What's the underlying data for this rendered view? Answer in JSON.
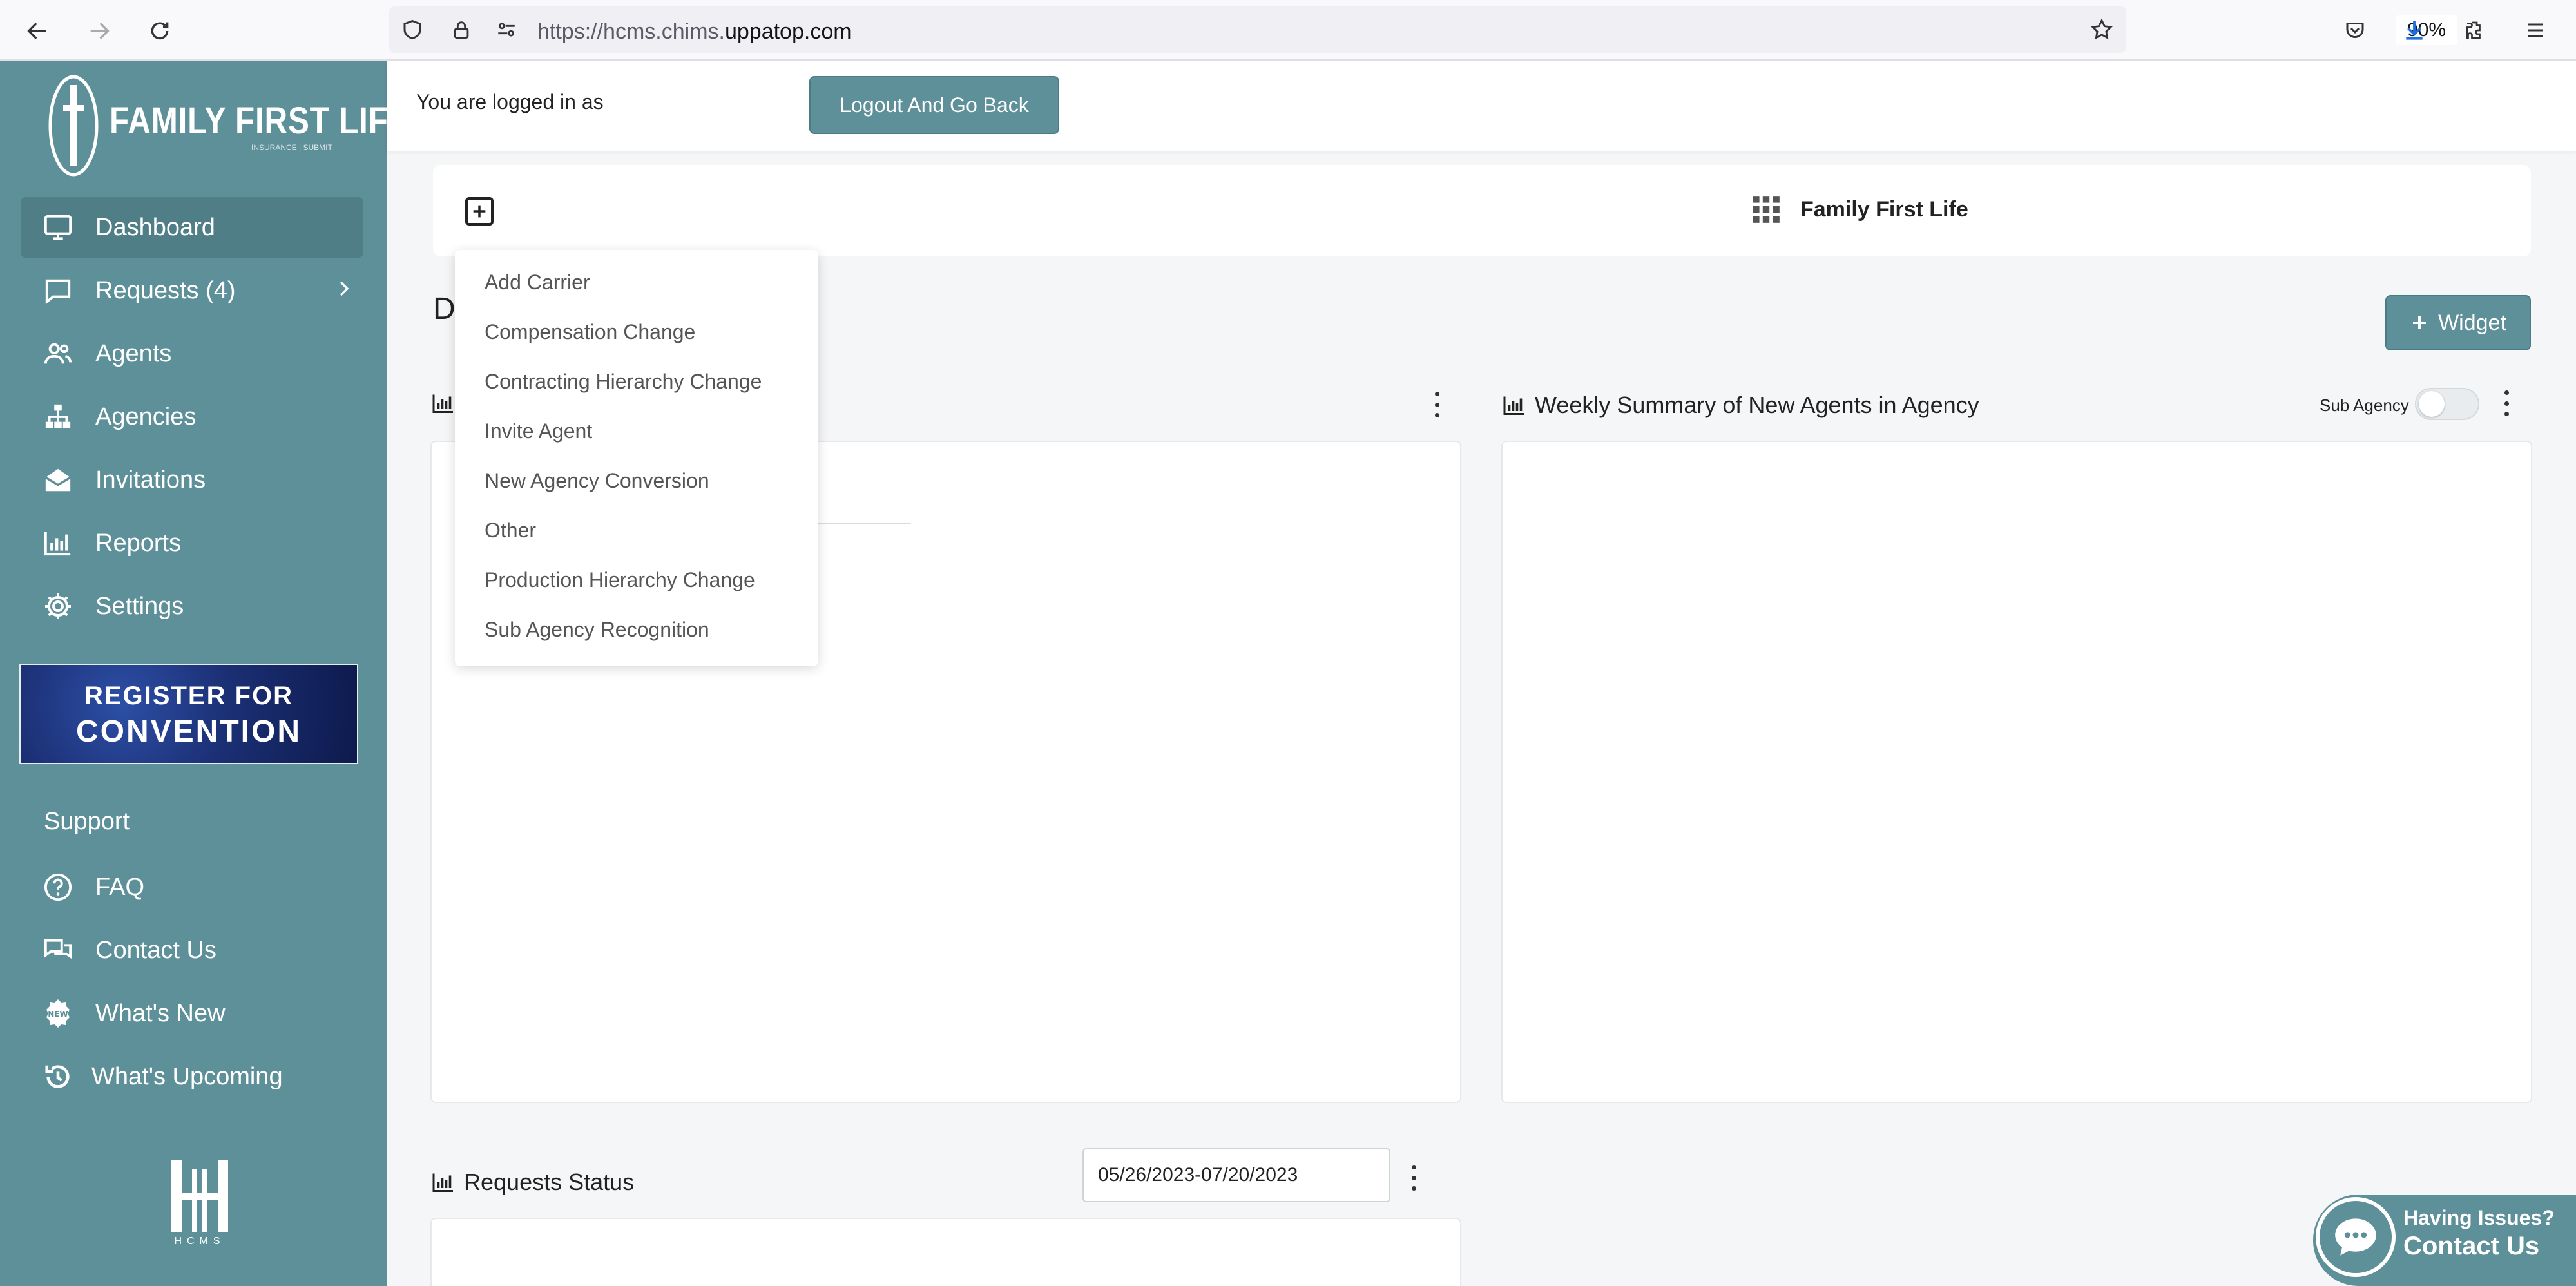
{
  "browser": {
    "url_prefix": "https://hcms.chims.",
    "url_host": "uppatop.com",
    "zoom": "90%"
  },
  "sidebar": {
    "logo_text": "FAMILY FIRST LIFE",
    "logo_sub": "INSURANCE | SUBMIT",
    "items": [
      {
        "label": "Dashboard",
        "icon": "monitor-icon"
      },
      {
        "label": "Requests (4)",
        "icon": "chat-icon"
      },
      {
        "label": "Agents",
        "icon": "users-icon"
      },
      {
        "label": "Agencies",
        "icon": "hierarchy-icon"
      },
      {
        "label": "Invitations",
        "icon": "envelope-icon"
      },
      {
        "label": "Reports",
        "icon": "bar-chart-icon"
      },
      {
        "label": "Settings",
        "icon": "gear-icon"
      }
    ],
    "banner": {
      "line1": "REGISTER FOR",
      "line2": "CONVENTION"
    },
    "support_label": "Support",
    "support_items": [
      {
        "label": "FAQ",
        "icon": "question-icon"
      },
      {
        "label": "Contact Us",
        "icon": "comments-icon"
      },
      {
        "label": "What's New",
        "icon": "new-badge-icon"
      },
      {
        "label": "What's Upcoming",
        "icon": "history-icon"
      }
    ],
    "bottom_logo_text": "HCMS"
  },
  "topbar": {
    "logged_in_text": "You are logged in as",
    "logout_label": "Logout And Go Back"
  },
  "subheader": {
    "org_name": "Family First Life"
  },
  "dashboard": {
    "heading": "D",
    "widget_button": "Widget",
    "weekly_title": "Weekly Summary of New Agents in Agency",
    "sub_agency_label": "Sub Agency",
    "requests_status_title": "Requests Status",
    "date_range": "05/26/2023-07/20/2023"
  },
  "dropdown": {
    "items": [
      "Add Carrier",
      "Compensation Change",
      "Contracting Hierarchy Change",
      "Invite Agent",
      "New Agency Conversion",
      "Other",
      "Production Hierarchy Change",
      "Sub Agency Recognition"
    ]
  },
  "chat": {
    "line1": "Having Issues?",
    "line2": "Contact Us"
  },
  "colors": {
    "sidebar": "#5e9099",
    "accent": "#5e9099"
  }
}
